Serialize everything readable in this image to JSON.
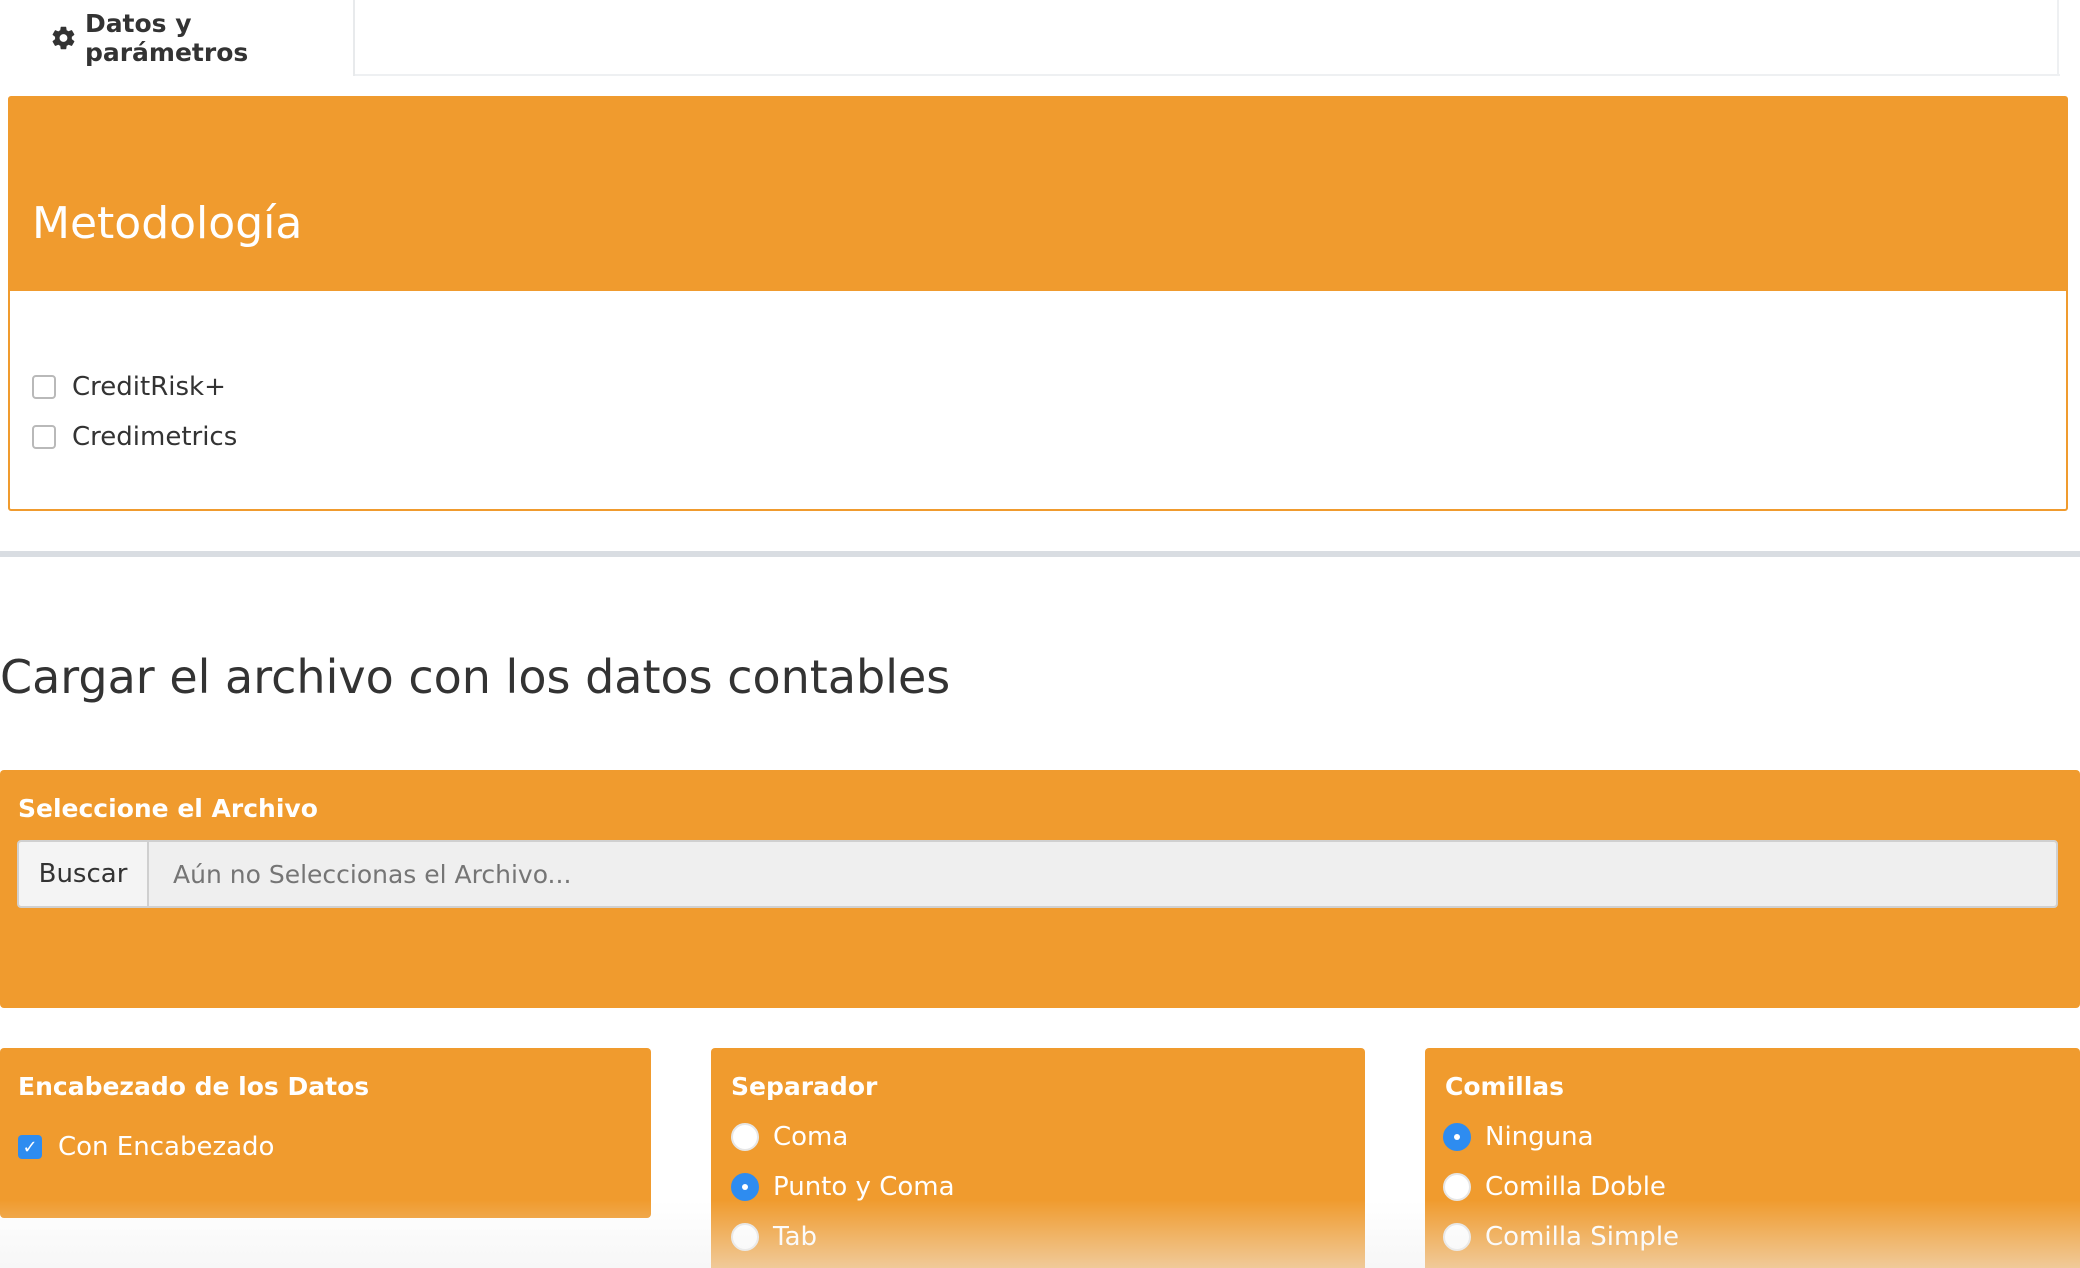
{
  "tab": {
    "label": "Datos y parámetros"
  },
  "metodologia": {
    "title": "Metodología",
    "options": [
      {
        "label": "CreditRisk+",
        "checked": false
      },
      {
        "label": "Credimetrics",
        "checked": false
      }
    ]
  },
  "upload": {
    "heading": "Cargar el archivo con los datos contables",
    "select_label": "Seleccione el Archivo",
    "browse_label": "Buscar",
    "placeholder": "Aún no Seleccionas el Archivo..."
  },
  "header_opts": {
    "title": "Encabezado de los Datos",
    "checkbox_label": "Con Encabezado",
    "checked": true
  },
  "separator": {
    "title": "Separador",
    "options": [
      "Coma",
      "Punto y Coma",
      "Tab"
    ],
    "selected": "Punto y Coma"
  },
  "quotes": {
    "title": "Comillas",
    "options": [
      "Ninguna",
      "Comilla Doble",
      "Comilla Simple"
    ],
    "selected": "Ninguna"
  },
  "colors": {
    "accent": "#f09b2e",
    "selected": "#2e8cf0"
  }
}
